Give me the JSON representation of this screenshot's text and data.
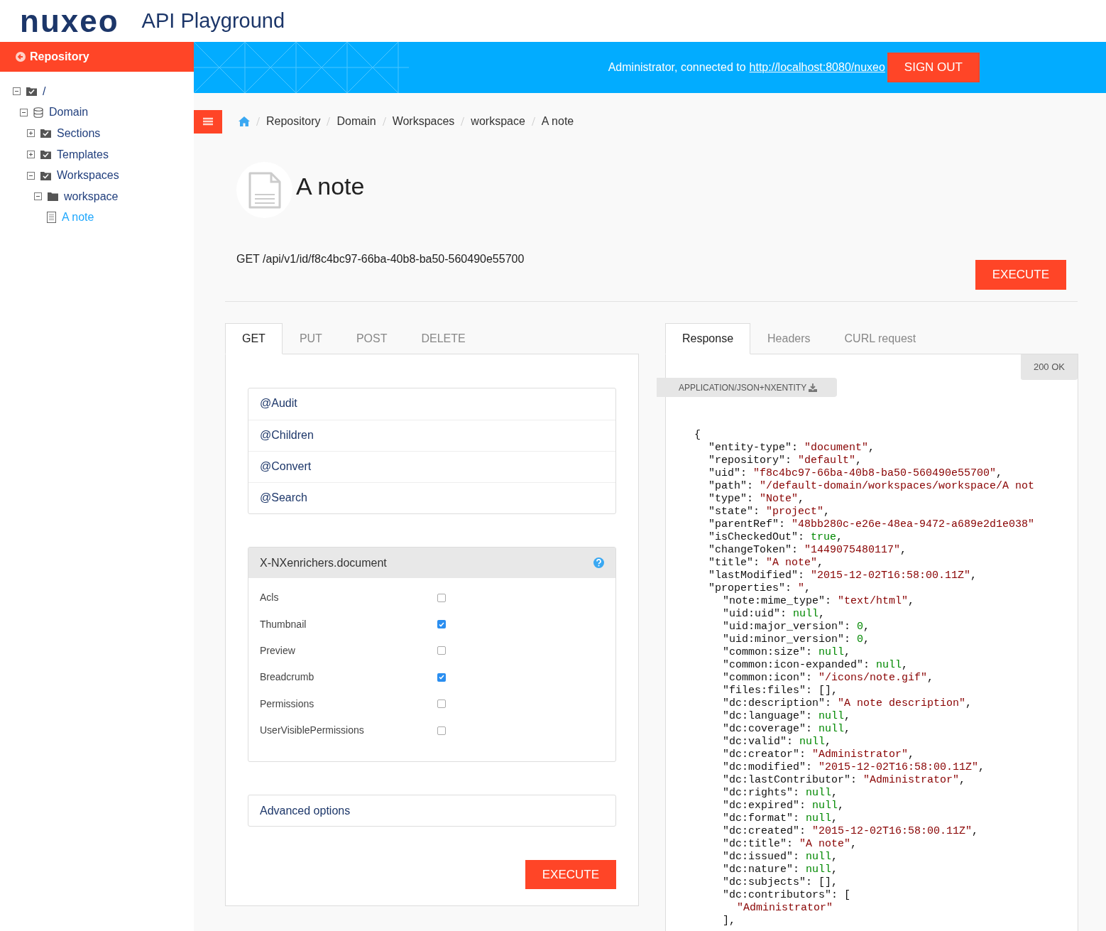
{
  "header": {
    "logo": "nuxeo",
    "title": "API Playground"
  },
  "sidebar": {
    "title": "Repository",
    "tree": [
      {
        "label": "/",
        "kind": "root",
        "expanded": true,
        "selected": false,
        "children": [
          {
            "label": "Domain",
            "kind": "domain",
            "expanded": true,
            "selected": false,
            "children": [
              {
                "label": "Sections",
                "kind": "folder",
                "expanded": false,
                "selected": false
              },
              {
                "label": "Templates",
                "kind": "folder",
                "expanded": false,
                "selected": false
              },
              {
                "label": "Workspaces",
                "kind": "folder",
                "expanded": true,
                "selected": false,
                "children": [
                  {
                    "label": "workspace",
                    "kind": "workspace",
                    "expanded": true,
                    "selected": false,
                    "children": [
                      {
                        "label": "A note",
                        "kind": "note",
                        "selected": true
                      }
                    ]
                  }
                ]
              }
            ]
          }
        ]
      }
    ]
  },
  "banner": {
    "connected_text": "Administrator, connected to",
    "server_link": "http://localhost:8080/nuxeo",
    "sign_out": "SIGN OUT"
  },
  "breadcrumb": [
    "Repository",
    "Domain",
    "Workspaces",
    "workspace",
    "A note"
  ],
  "document": {
    "title": "A note",
    "request": "GET /api/v1/id/f8c4bc97-66ba-40b8-ba50-560490e55700",
    "execute": "EXECUTE"
  },
  "method_tabs": [
    {
      "label": "GET",
      "selected": true
    },
    {
      "label": "PUT",
      "selected": false
    },
    {
      "label": "POST",
      "selected": false
    },
    {
      "label": "DELETE",
      "selected": false
    }
  ],
  "adapters": [
    "@Audit",
    "@Children",
    "@Convert",
    "@Search"
  ],
  "enrichers": {
    "title": "X-NXenrichers.document",
    "items": [
      {
        "label": "Acls",
        "checked": false
      },
      {
        "label": "Thumbnail",
        "checked": true
      },
      {
        "label": "Preview",
        "checked": false
      },
      {
        "label": "Breadcrumb",
        "checked": true
      },
      {
        "label": "Permissions",
        "checked": false
      },
      {
        "label": "UserVisiblePermissions",
        "checked": false
      }
    ]
  },
  "advanced_options": "Advanced options",
  "execute": "EXECUTE",
  "response_tabs": [
    {
      "label": "Response",
      "selected": true
    },
    {
      "label": "Headers",
      "selected": false
    },
    {
      "label": "CURL request",
      "selected": false
    }
  ],
  "status": "200 OK",
  "content_type": "APPLICATION/JSON+NXENTITY",
  "body": {
    "open": "{",
    "children": [
      {
        "key": "\"entity-type\":",
        "value": "\"document\"",
        "kind": "string",
        "tail": ","
      },
      {
        "key": "\"repository\":",
        "value": "\"default\"",
        "kind": "string",
        "tail": ","
      },
      {
        "key": "\"uid\":",
        "value": "\"f8c4bc97-66ba-40b8-ba50-560490e55700\"",
        "kind": "string",
        "tail": ","
      },
      {
        "key": "\"path\":",
        "value": "\"/default-domain/workspaces/workspace/A not",
        "kind": "string"
      },
      {
        "key": "\"type\":",
        "value": "\"Note\"",
        "kind": "string",
        "tail": ","
      },
      {
        "key": "\"state\":",
        "value": "\"project\"",
        "kind": "string",
        "tail": ","
      },
      {
        "key": "\"parentRef\":",
        "value": "\"48bb280c-e26e-48ea-9472-a689e2d1e038\"",
        "kind": "string"
      },
      {
        "key": "\"isCheckedOut\":",
        "value": "true",
        "kind": "literal",
        "tail": ","
      },
      {
        "key": "\"changeToken\":",
        "value": "\"1449075480117\"",
        "kind": "string",
        "tail": ","
      },
      {
        "key": "\"title\":",
        "value": "\"A note\"",
        "kind": "string",
        "tail": ","
      },
      {
        "key": "\"lastModified\":",
        "value": "\"2015-12-02T16:58:00.11Z\"",
        "kind": "string",
        "tail": ","
      },
      {
        "key": "\"properties\":",
        "value": "\"",
        "kind": "string",
        "tail": ",",
        "children": [
          {
            "key": "\"note:mime_type\":",
            "value": "\"text/html\"",
            "kind": "string",
            "tail": ","
          },
          {
            "key": "\"uid:uid\":",
            "value": "null",
            "kind": "literal",
            "tail": ","
          },
          {
            "key": "\"uid:major_version\":",
            "value": "0",
            "kind": "literal",
            "tail": ","
          },
          {
            "key": "\"uid:minor_version\":",
            "value": "0",
            "kind": "literal",
            "tail": ","
          },
          {
            "key": "\"common:size\":",
            "value": "null",
            "kind": "literal",
            "tail": ","
          },
          {
            "key": "\"common:icon-expanded\":",
            "value": "null",
            "kind": "literal",
            "tail": ","
          },
          {
            "key": "\"common:icon\":",
            "value": "\"/icons/note.gif\"",
            "kind": "string",
            "tail": ","
          },
          {
            "key": "\"files:files\":",
            "value": "[],",
            "kind": "plain"
          },
          {
            "key": "\"dc:description\":",
            "value": "\"A note description\"",
            "kind": "string",
            "tail": ","
          },
          {
            "key": "\"dc:language\":",
            "value": "null",
            "kind": "literal",
            "tail": ","
          },
          {
            "key": "\"dc:coverage\":",
            "value": "null",
            "kind": "literal",
            "tail": ","
          },
          {
            "key": "\"dc:valid\":",
            "value": "null",
            "kind": "literal",
            "tail": ","
          },
          {
            "key": "\"dc:creator\":",
            "value": "\"Administrator\"",
            "kind": "string",
            "tail": ","
          },
          {
            "key": "\"dc:modified\":",
            "value": "\"2015-12-02T16:58:00.11Z\"",
            "kind": "string",
            "tail": ","
          },
          {
            "key": "\"dc:lastContributor\":",
            "value": "\"Administrator\"",
            "kind": "string",
            "tail": ","
          },
          {
            "key": "\"dc:rights\":",
            "value": "null",
            "kind": "literal",
            "tail": ","
          },
          {
            "key": "\"dc:expired\":",
            "value": "null",
            "kind": "literal",
            "tail": ","
          },
          {
            "key": "\"dc:format\":",
            "value": "null",
            "kind": "literal",
            "tail": ","
          },
          {
            "key": "\"dc:created\":",
            "value": "\"2015-12-02T16:58:00.11Z\"",
            "kind": "string",
            "tail": ","
          },
          {
            "key": "\"dc:title\":",
            "value": "\"A note\"",
            "kind": "string",
            "tail": ","
          },
          {
            "key": "\"dc:issued\":",
            "value": "null",
            "kind": "literal",
            "tail": ","
          },
          {
            "key": "\"dc:nature\":",
            "value": "null",
            "kind": "literal",
            "tail": ","
          },
          {
            "key": "\"dc:subjects\":",
            "value": "[],",
            "kind": "plain"
          },
          {
            "key": "\"dc:contributors\":",
            "value": "[",
            "kind": "plain",
            "close": "],",
            "children": [
              {
                "value": "\"Administrator\"",
                "kind": "string"
              }
            ]
          }
        ]
      }
    ]
  }
}
